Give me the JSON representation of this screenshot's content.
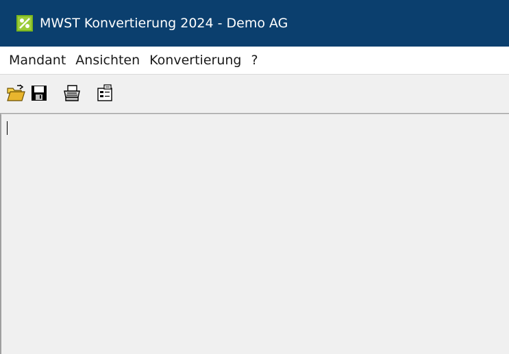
{
  "window": {
    "title": "MWST Konvertierung 2024 - Demo AG",
    "app_icon": "app-icon"
  },
  "menu": {
    "items": [
      {
        "label": "Mandant"
      },
      {
        "label": "Ansichten"
      },
      {
        "label": "Konvertierung"
      },
      {
        "label": "?"
      }
    ]
  },
  "toolbar": {
    "buttons": [
      {
        "icon": "open-folder-icon"
      },
      {
        "icon": "save-icon"
      },
      {
        "icon": "print-icon"
      },
      {
        "icon": "properties-icon"
      }
    ]
  },
  "colors": {
    "titlebar": "#0b3f6e",
    "menubar": "#ffffff",
    "client": "#f0f0f0"
  }
}
